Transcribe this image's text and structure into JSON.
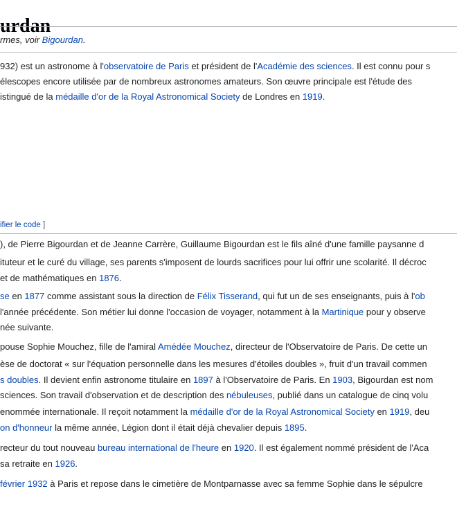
{
  "page_title": "urdan",
  "hatnote": {
    "prefix": "rmes, voir ",
    "link": "Bigourdan",
    "suffix": "."
  },
  "intro": [
    [
      {
        "t": "932) est un astronome à l'"
      },
      {
        "t": "observatoire de Paris",
        "link": true
      },
      {
        "t": " et président de l'"
      },
      {
        "t": "Académie des sciences",
        "link": true
      },
      {
        "t": ". Il est connu pour s"
      }
    ],
    [
      {
        "t": "élescopes encore utilisée par de nombreux astronomes amateurs. Son œuvre principale est l'étude des"
      }
    ],
    [
      {
        "t": "istingué de la "
      },
      {
        "t": "médaille d'or de la Royal Astronomical Society",
        "link": true
      },
      {
        "t": " de Londres en "
      },
      {
        "t": "1919",
        "link": true
      },
      {
        "t": "."
      }
    ]
  ],
  "section_edit": {
    "text": "ifier le code",
    "bracket_close": " ]"
  },
  "body_lines": [
    [
      {
        "t": "), de Pierre Bigourdan et de Jeanne Carrère, Guillaume Bigourdan est le fils aîné d'une famille paysanne d"
      }
    ],
    [
      {
        "t": "ituteur et le curé du village, ses parents s'imposent de lourds sacrifices pour lui offrir une scolarité. Il décroc"
      }
    ],
    [
      {
        "t": " et de mathématiques en "
      },
      {
        "t": "1876",
        "link": true
      },
      {
        "t": "."
      }
    ],
    [
      {
        "t": "se",
        "link": true
      },
      {
        "t": " en "
      },
      {
        "t": "1877",
        "link": true
      },
      {
        "t": " comme assistant sous la direction de "
      },
      {
        "t": "Félix Tisserand",
        "link": true
      },
      {
        "t": ", qui fut un de ses enseignants, puis à l'"
      },
      {
        "t": "ob",
        "link": true
      }
    ],
    [
      {
        "t": " l'année précédente. Son métier lui donne l'occasion de voyager, notamment à la "
      },
      {
        "t": "Martinique",
        "link": true
      },
      {
        "t": " pour y observe"
      }
    ],
    [
      {
        "t": "née suivante."
      }
    ],
    [
      {
        "t": "pouse Sophie Mouchez, fille de l'amiral "
      },
      {
        "t": "Amédée Mouchez",
        "link": true
      },
      {
        "t": ", directeur de l'Observatoire de Paris. De cette un"
      }
    ],
    [
      {
        "t": "èse de doctorat « sur l'équation personnelle dans les mesures d'étoiles doubles », fruit d'un travail commen"
      }
    ],
    [
      {
        "t": "s doubles",
        "link": true
      },
      {
        "t": ". Il devient enfin astronome titulaire en "
      },
      {
        "t": "1897",
        "link": true
      },
      {
        "t": " à l'Observatoire de Paris. En "
      },
      {
        "t": "1903",
        "link": true
      },
      {
        "t": ", Bigourdan est nom"
      }
    ],
    [
      {
        "t": "sciences. Son travail d'observation et de description des "
      },
      {
        "t": "nébuleuses",
        "link": true
      },
      {
        "t": ", publié dans un catalogue de cinq volu"
      }
    ],
    [
      {
        "t": "enommée internationale. Il reçoit notamment la "
      },
      {
        "t": "médaille d'or de la Royal Astronomical Society",
        "link": true
      },
      {
        "t": " en "
      },
      {
        "t": "1919",
        "link": true
      },
      {
        "t": ", deu"
      }
    ],
    [
      {
        "t": "on d'honneur",
        "link": true
      },
      {
        "t": " la même année, Légion dont il était déjà chevalier depuis "
      },
      {
        "t": "1895",
        "link": true
      },
      {
        "t": "."
      }
    ],
    [
      {
        "t": "recteur du tout nouveau "
      },
      {
        "t": "bureau international de l'heure",
        "link": true
      },
      {
        "t": " en "
      },
      {
        "t": "1920",
        "link": true
      },
      {
        "t": ". Il est également nommé président de l'Aca"
      }
    ],
    [
      {
        "t": " sa retraite en "
      },
      {
        "t": "1926",
        "link": true
      },
      {
        "t": "."
      }
    ],
    [
      {
        "t": " février 1932",
        "link": true
      },
      {
        "t": " à Paris et repose dans le cimetière de Montparnasse avec sa femme Sophie dans le sépulcre"
      }
    ]
  ],
  "colors": {
    "link": "#0645ad",
    "text": "#202122",
    "rule": "#a2a9b1"
  }
}
